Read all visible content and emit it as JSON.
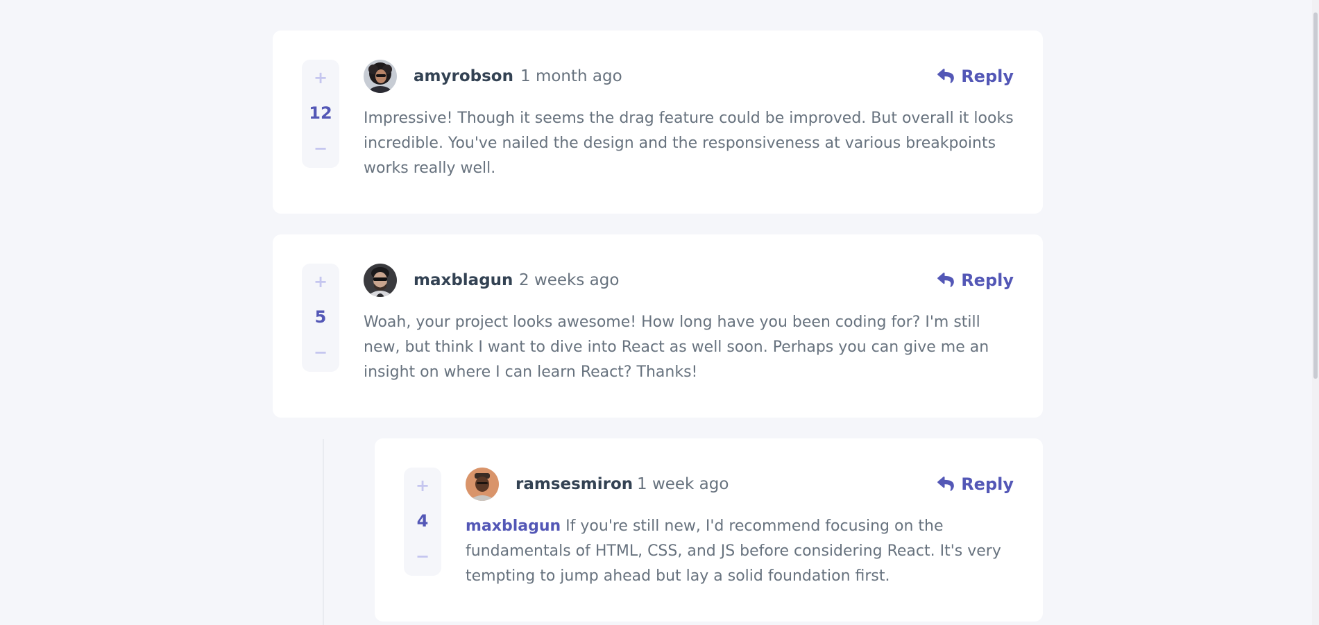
{
  "colors": {
    "background": "#f5f6fa",
    "card": "#ffffff",
    "accent": "#5357b6",
    "vote_inactive": "#c5c6ef",
    "username": "#334253",
    "text": "#67727e"
  },
  "comments": [
    {
      "score": "12",
      "username": "amyrobson",
      "time": "1 month ago",
      "reply_label": "Reply",
      "mention": "",
      "content": "Impressive! Though it seems the drag feature could be improved. But overall it looks incredible. You've nailed the design and the responsiveness at various breakpoints works really well."
    },
    {
      "score": "5",
      "username": "maxblagun",
      "time": "2 weeks ago",
      "reply_label": "Reply",
      "mention": "",
      "content": "Woah, your project looks awesome! How long have you been coding for? I'm still new, but think I want to dive into React as well soon. Perhaps you can give me an insight on where I can learn React? Thanks!"
    }
  ],
  "replies": [
    {
      "score": "4",
      "username": "ramsesmiron",
      "time": "1 week ago",
      "reply_label": "Reply",
      "mention": "maxblagun",
      "content": "If you're still new, I'd recommend focusing on the fundamentals of HTML, CSS, and JS before considering React. It's very tempting to jump ahead but lay a solid foundation first."
    }
  ],
  "icons": {
    "upvote": "+",
    "downvote": "−",
    "reply": "reply-arrow-icon"
  }
}
